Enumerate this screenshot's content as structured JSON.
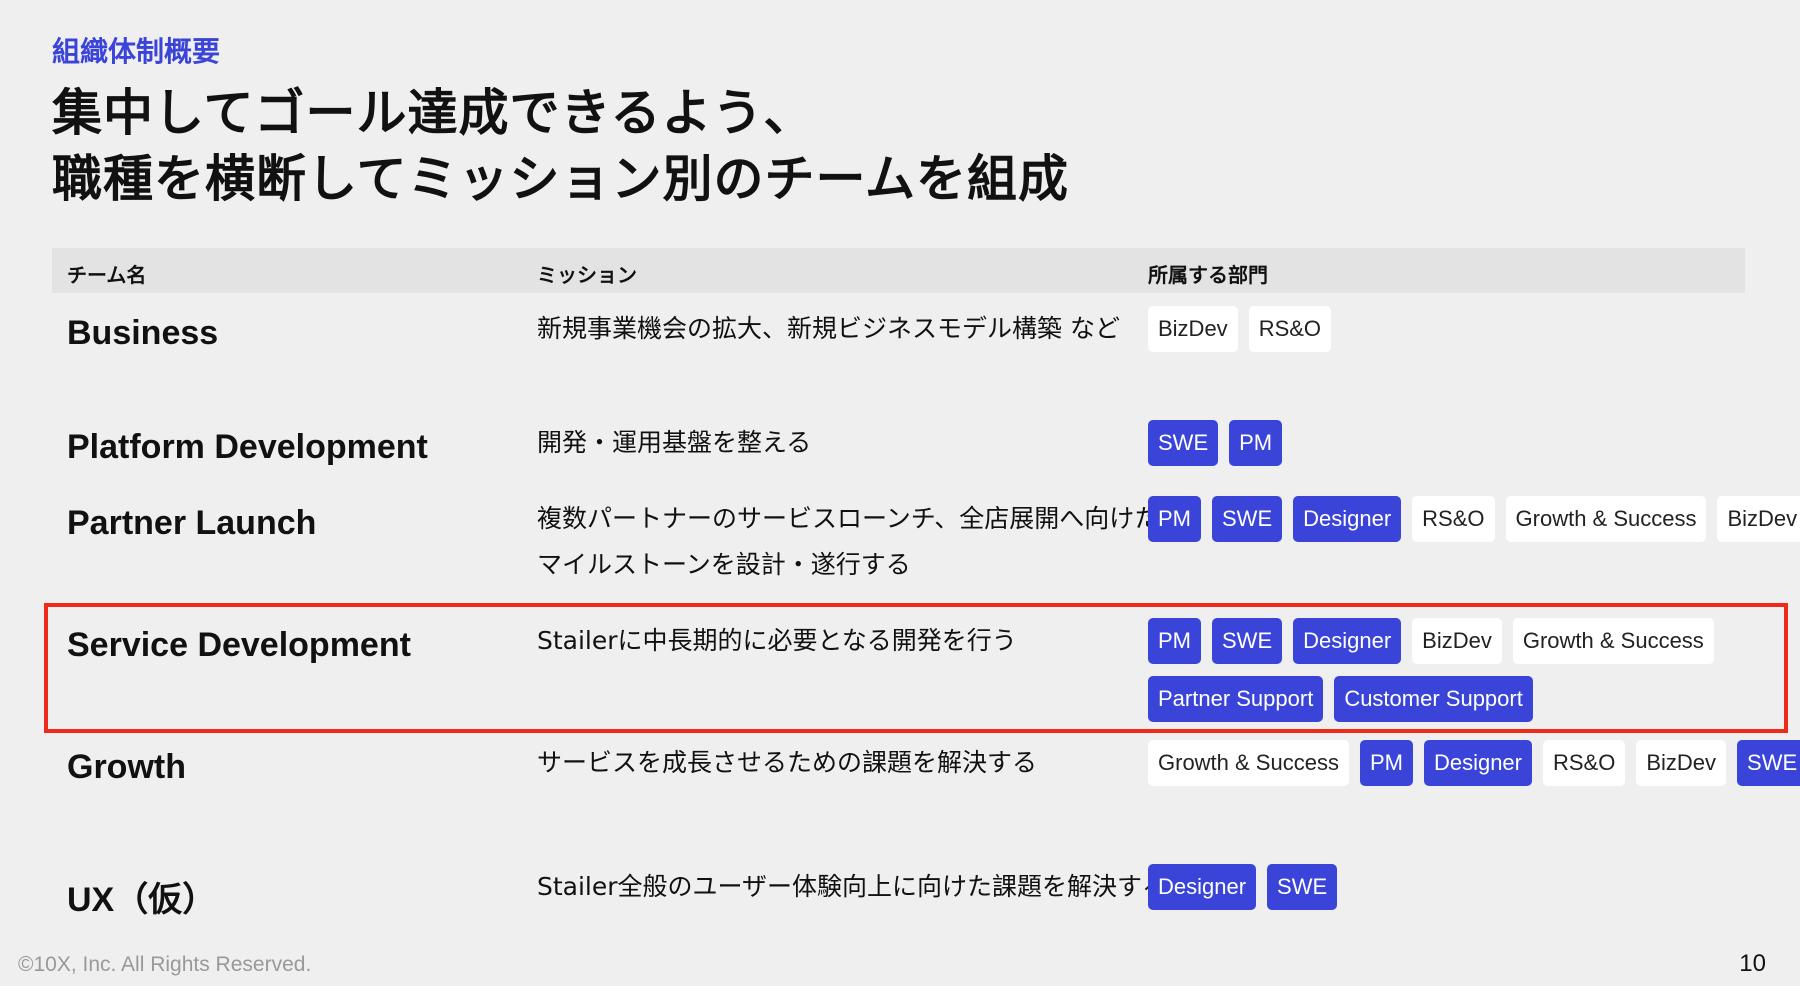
{
  "section_label": "組織体制概要",
  "title": {
    "line1": "集中してゴール達成できるよう、",
    "line2": "職種を横断してミッション別のチームを組成"
  },
  "table": {
    "headers": [
      "チーム名",
      "ミッション",
      "所属する部門"
    ],
    "rows": [
      {
        "name": "Business",
        "mission": "新規事業機会の拡大、新規ビジネスモデル構築 など",
        "tags": [
          {
            "label": "BizDev",
            "style": "white"
          },
          {
            "label": "RS&O",
            "style": "white"
          }
        ]
      },
      {
        "name": "Platform Development",
        "mission": "開発・運用基盤を整える",
        "tags": [
          {
            "label": "SWE",
            "style": "blue"
          },
          {
            "label": "PM",
            "style": "blue"
          }
        ]
      },
      {
        "name": "Partner Launch",
        "mission": "複数パートナーのサービスローンチ、全店展開へ向けたマイルストーンを設計・遂行する",
        "tags": [
          {
            "label": "PM",
            "style": "blue"
          },
          {
            "label": "SWE",
            "style": "blue"
          },
          {
            "label": "Designer",
            "style": "blue"
          },
          {
            "label": "RS&O",
            "style": "white"
          },
          {
            "label": "Growth & Success",
            "style": "white"
          },
          {
            "label": "BizDev",
            "style": "white"
          }
        ]
      },
      {
        "name": "Service Development",
        "mission": "Stailerに中長期的に必要となる開発を行う",
        "highlighted": true,
        "tags": [
          {
            "label": "PM",
            "style": "blue"
          },
          {
            "label": "SWE",
            "style": "blue"
          },
          {
            "label": "Designer",
            "style": "blue"
          },
          {
            "label": "BizDev",
            "style": "white"
          },
          {
            "label": "Growth & Success",
            "style": "white"
          },
          {
            "label": "Partner Support",
            "style": "blue"
          },
          {
            "label": "Customer Support",
            "style": "blue"
          }
        ]
      },
      {
        "name": "Growth",
        "mission": "サービスを成長させるための課題を解決する",
        "tags": [
          {
            "label": "Growth & Success",
            "style": "white"
          },
          {
            "label": "PM",
            "style": "blue"
          },
          {
            "label": "Designer",
            "style": "blue"
          },
          {
            "label": "RS&O",
            "style": "white"
          },
          {
            "label": "BizDev",
            "style": "white"
          },
          {
            "label": "SWE",
            "style": "blue"
          }
        ]
      },
      {
        "name": "UX（仮）",
        "mission": "Stailer全般のユーザー体験向上に向けた課題を解決する",
        "tags": [
          {
            "label": "Designer",
            "style": "blue"
          },
          {
            "label": "SWE",
            "style": "blue"
          }
        ]
      }
    ]
  },
  "footer": {
    "copyright": "©10X, Inc. All Rights Reserved.",
    "page_number": "10"
  },
  "colors": {
    "accent": "#3a44d8",
    "highlight": "#ee2a1b",
    "background": "#efefef"
  }
}
